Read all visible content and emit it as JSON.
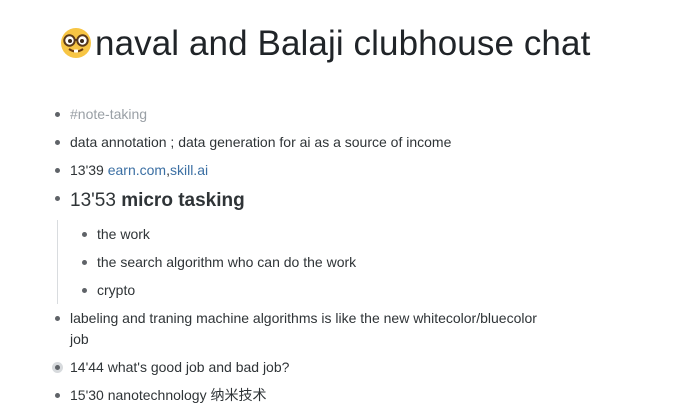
{
  "page": {
    "title": "naval and Balaji clubhouse chat",
    "title_icon": "nerd-face-emoji"
  },
  "blocks": [
    {
      "tag": "#note-taking"
    },
    {
      "text": "data annotation ; data generation for ai as a source of income"
    },
    {
      "prefix": "13'39 ",
      "link1": "earn.com",
      "separator": ",",
      "link2": "skill.ai"
    },
    {
      "prefix": "13'53 ",
      "bold": "micro tasking",
      "children": [
        {
          "text": "the work"
        },
        {
          "text": "the search algorithm who can do the work"
        },
        {
          "text": "crypto"
        }
      ]
    },
    {
      "line1": "labeling and traning machine algorithms is like the new whitecolor/bluecolor",
      "line2": "job"
    },
    {
      "text": "14'44 what's good job and bad job?",
      "collapsed": true
    },
    {
      "text": "15'30 nanotechnology 纳米技术"
    }
  ],
  "colors": {
    "text": "#2f3437",
    "tag": "#9aa0a6",
    "link": "#3b6fa3",
    "bullet": "#5f6368"
  }
}
